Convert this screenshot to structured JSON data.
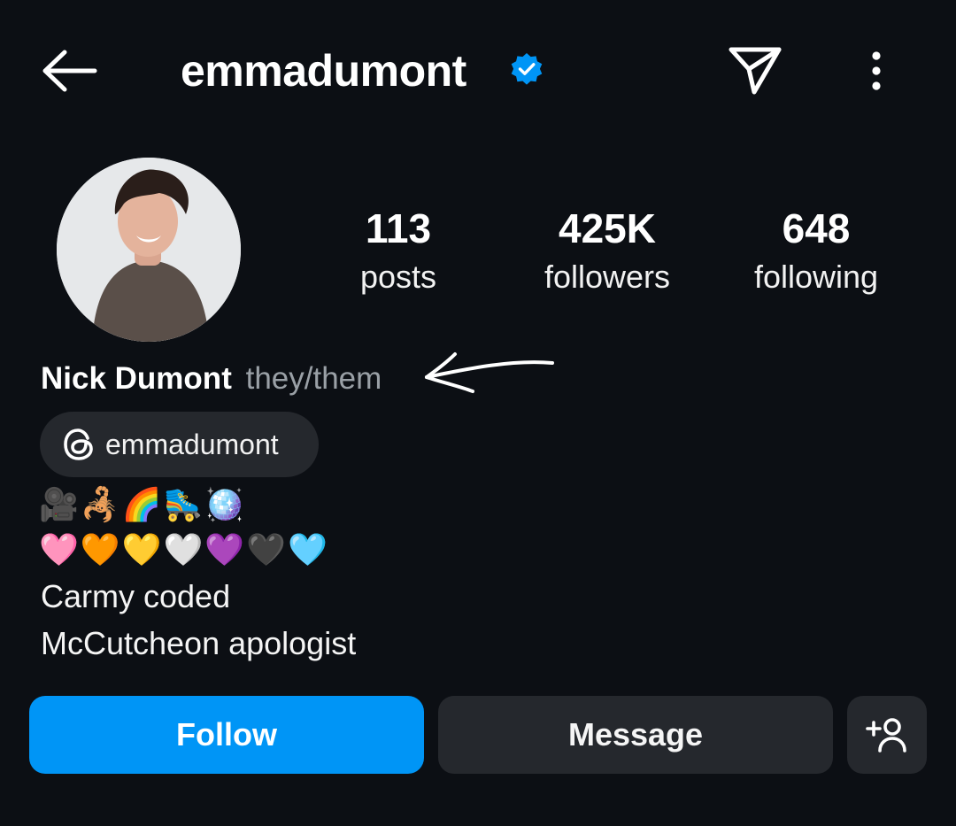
{
  "header": {
    "username": "emmadumont",
    "verified": true,
    "accent_color": "#0095f6"
  },
  "icons": {
    "back": "back-arrow-icon",
    "verified": "verified-badge-icon",
    "send": "paper-plane-icon",
    "more": "more-vertical-icon",
    "threads": "threads-icon",
    "add_user": "add-user-icon"
  },
  "stats": {
    "posts_value": "113",
    "posts_label": "posts",
    "followers_value": "425K",
    "followers_label": "followers",
    "following_value": "648",
    "following_label": "following"
  },
  "profile": {
    "display_name": "Nick Dumont",
    "pronouns": "they/them",
    "threads_handle": "emmadumont",
    "emoji_line_1": "🎥🦂🌈🛼🪩",
    "emoji_line_2": "🩷🧡💛🤍💜🖤🩵",
    "bio_line_1": "Carmy coded",
    "bio_line_2": "McCutcheon apologist"
  },
  "actions": {
    "follow_label": "Follow",
    "message_label": "Message"
  }
}
